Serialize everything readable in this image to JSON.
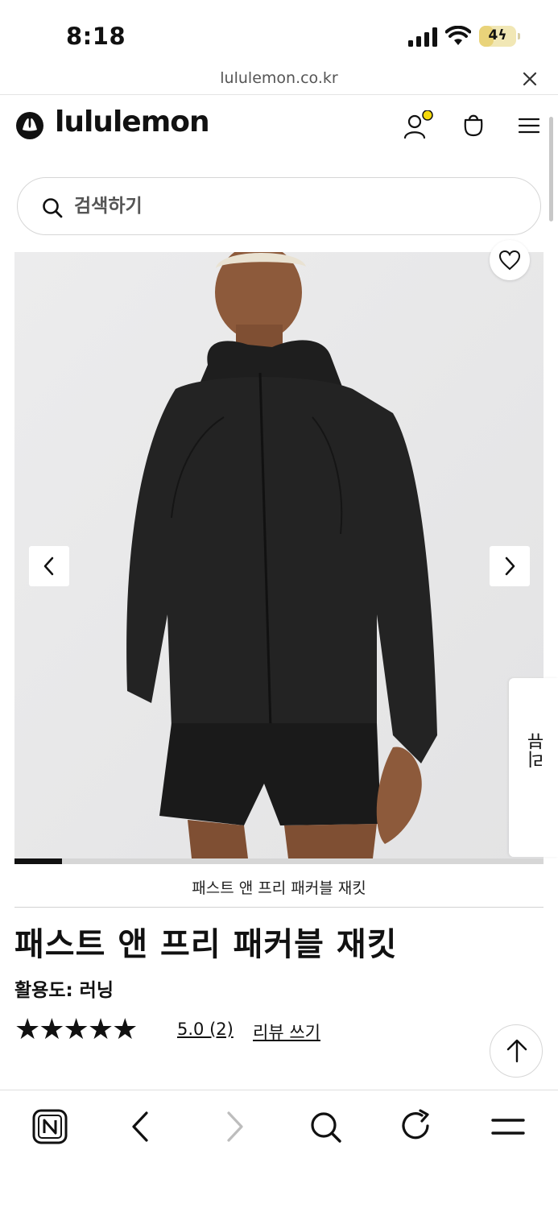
{
  "status_bar": {
    "time": "8:18",
    "battery_level": "4",
    "battery_percent": 0.4,
    "battery_color": "#e9d37a"
  },
  "browser": {
    "url": "lululemon.co.kr",
    "close_icon": "close-icon"
  },
  "header": {
    "logo_text": "lululemon",
    "icons": [
      "lululemon-logo-icon",
      "account-icon",
      "shopping-bag-icon",
      "menu-icon"
    ],
    "notification_dot_color": "#f5d90a"
  },
  "search": {
    "placeholder": "검색하기",
    "value": ""
  },
  "gallery": {
    "review_tab_label": "리뷰",
    "progress": 0.09,
    "icons": [
      "heart-icon",
      "chevron-left-icon",
      "chevron-right-icon"
    ]
  },
  "product": {
    "caption": "패스트 앤 프리 패커블 재킷",
    "title": "패스트 앤 프리 패커블 재킷",
    "activity": "활용도: 러닝",
    "stars": "★★★★★",
    "rating": 5.0,
    "rating_text": "5.0 (2)",
    "write_review_label": "리뷰 쓰기"
  },
  "toolbar": {
    "icons": [
      "tab-n-icon",
      "back-icon",
      "forward-icon",
      "search-icon",
      "reload-icon",
      "menu-icon"
    ]
  }
}
